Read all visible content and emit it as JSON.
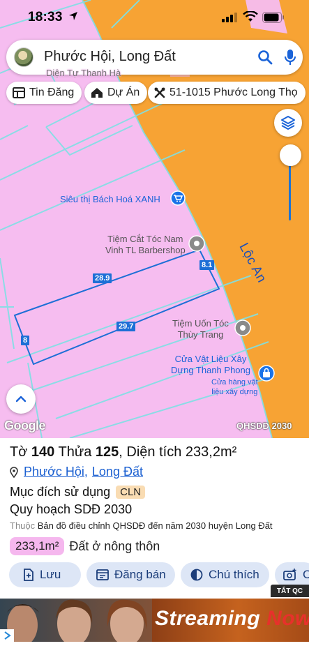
{
  "status_bar": {
    "time": "18:33"
  },
  "search": {
    "query": "Phước Hội, Long Đất"
  },
  "chips": [
    {
      "label": "Tin Đăng",
      "icon": "listing-icon"
    },
    {
      "label": "Dự Án",
      "icon": "project-house-icon"
    },
    {
      "label": "51-1015 Phước Long Thọ",
      "icon": "tools-icon"
    }
  ],
  "map": {
    "top_partial_label": "Diện Tự Thanh Hà",
    "road_name": "Lộc An",
    "pois": {
      "supermarket": "Siêu thị Bách Hoá XANH",
      "barber_line1": "Tiệm Cắt Tóc Nam",
      "barber_line2": "Vinh TL Barbershop",
      "hair_line1": "Tiệm Uốn Tóc",
      "hair_line2": "Thùy Trang",
      "materials_line1": "Cửa Vật Liệu Xây",
      "materials_line2": "Dựng Thanh Phong",
      "materials_sub1": "Cửa hàng vật",
      "materials_sub2": "liệu xây dựng"
    },
    "measurements": {
      "top": "28.9",
      "bottom": "29.7",
      "right": "8.1",
      "left": "8"
    },
    "attribution": "Google",
    "layer_label": "QHSDĐ 2030"
  },
  "parcel": {
    "sheet_label": "Tờ",
    "sheet_no": "140",
    "lot_label": "Thửa",
    "lot_no": "125",
    "area_text": "Diện tích 233,2m²",
    "ward": "Phước Hội",
    "district": "Long Đất",
    "purpose_label": "Mục đích sử dụng",
    "purpose_code": "CLN",
    "plan_title": "Quy hoạch SDĐ 2030",
    "belongs_prefix": "Thuộc",
    "belongs_text": "Bản đồ điều chỉnh QHSDĐ đến năm 2030 huyện Long Đất",
    "plan_area": "233,1m²",
    "plan_land_type": "Đất ở nông thôn"
  },
  "actions": [
    {
      "label": "Lưu",
      "icon": "save-plus-icon"
    },
    {
      "label": "Đăng bán",
      "icon": "post-listing-icon"
    },
    {
      "label": "Chú thích",
      "icon": "legend-contrast-icon"
    },
    {
      "label": "C",
      "icon": "camera-plus-icon"
    }
  ],
  "ad": {
    "close_label": "TẮT QC",
    "text_main": "Streaming",
    "text_accent": "Now"
  },
  "colors": {
    "land_pink": "#f6bdf0",
    "road_orange": "#f7a334",
    "accent_blue": "#1a63d8",
    "chip_bg": "#dde6f6"
  }
}
